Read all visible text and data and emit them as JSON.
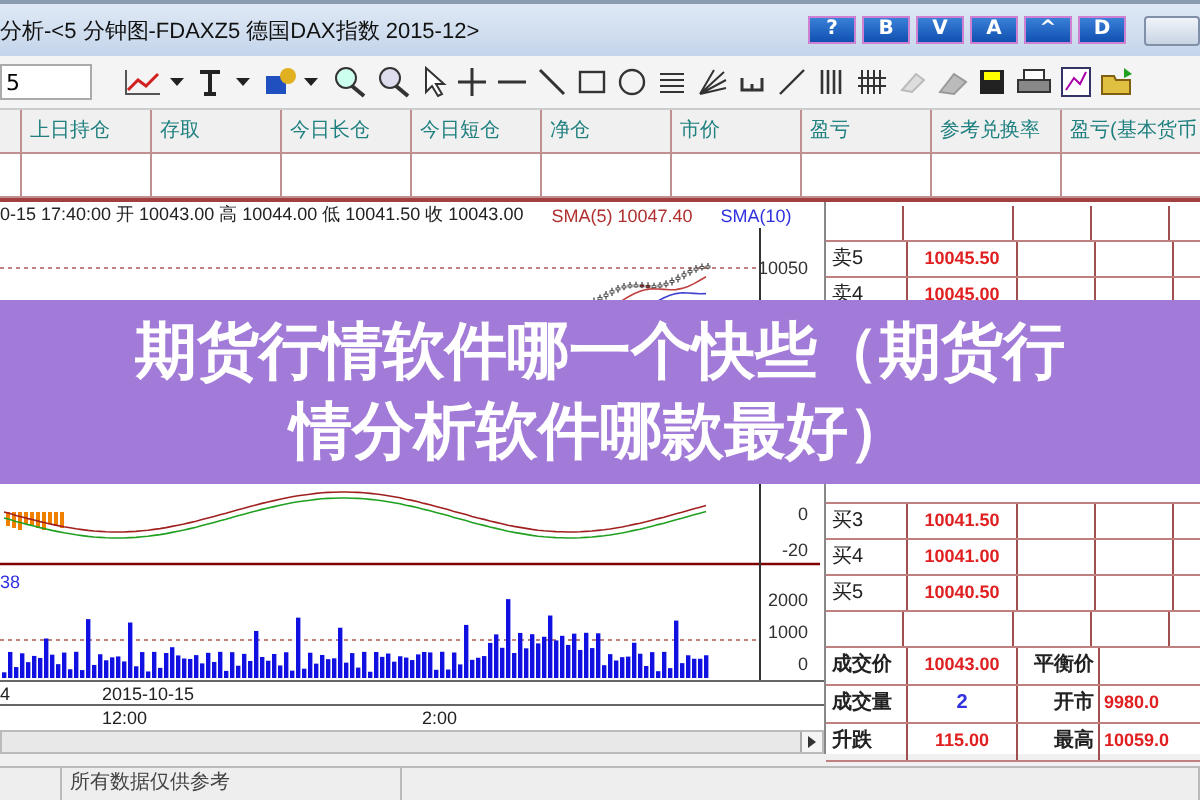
{
  "window": {
    "title": "分析-<5 分钟图-FDAXZ5 德国DAX指数 2015-12>",
    "title_buttons": [
      "?",
      "B",
      "V",
      "A",
      "^",
      "D"
    ]
  },
  "toolbar": {
    "interval_value": "5"
  },
  "positions_table": {
    "columns": [
      "上日持仓",
      "存取",
      "今日长仓",
      "今日短仓",
      "净仓",
      "市价",
      "盈亏",
      "参考兑换率",
      "盈亏(基本货币"
    ]
  },
  "chart": {
    "info": "0-15 17:40:00 开 10043.00 高 10044.00 低 10041.50 收 10043.00",
    "sma_5": "SMA(5) 10047.40",
    "sma_10": "SMA(10)",
    "volume_label": "38",
    "price_axis": [
      "10050"
    ],
    "macd_axis": [
      "0",
      "-20"
    ],
    "volume_axis": [
      "2000",
      "1000",
      "0"
    ],
    "date_labels": [
      "4",
      "2015-10-15"
    ],
    "time_labels": [
      "12:00",
      "2:00"
    ]
  },
  "quote_book": {
    "ask_rows": [
      {
        "label": "卖5",
        "price": "10045.50"
      },
      {
        "label": "卖4",
        "price": "10045.00"
      }
    ],
    "bid_rows": [
      {
        "label": "买3",
        "price": "10041.50"
      },
      {
        "label": "买4",
        "price": "10041.00"
      },
      {
        "label": "买5",
        "price": "10040.50"
      }
    ],
    "summary": [
      {
        "label": "成交价",
        "value": "10043.00",
        "kind": "price",
        "label_2": "平衡价"
      },
      {
        "label": "成交量",
        "value": "2",
        "kind": "count",
        "label_2": "开市",
        "value_2": "9980.0"
      },
      {
        "label": "升跌",
        "value": "115.00",
        "kind": "price",
        "label_2": "最高",
        "value_2": "10059.0"
      }
    ]
  },
  "status_bar": {
    "text": "所有数据仅供参考"
  },
  "banner": {
    "text": "期货行情软件哪一个快些（期货行情分析软件哪款最好）"
  }
}
